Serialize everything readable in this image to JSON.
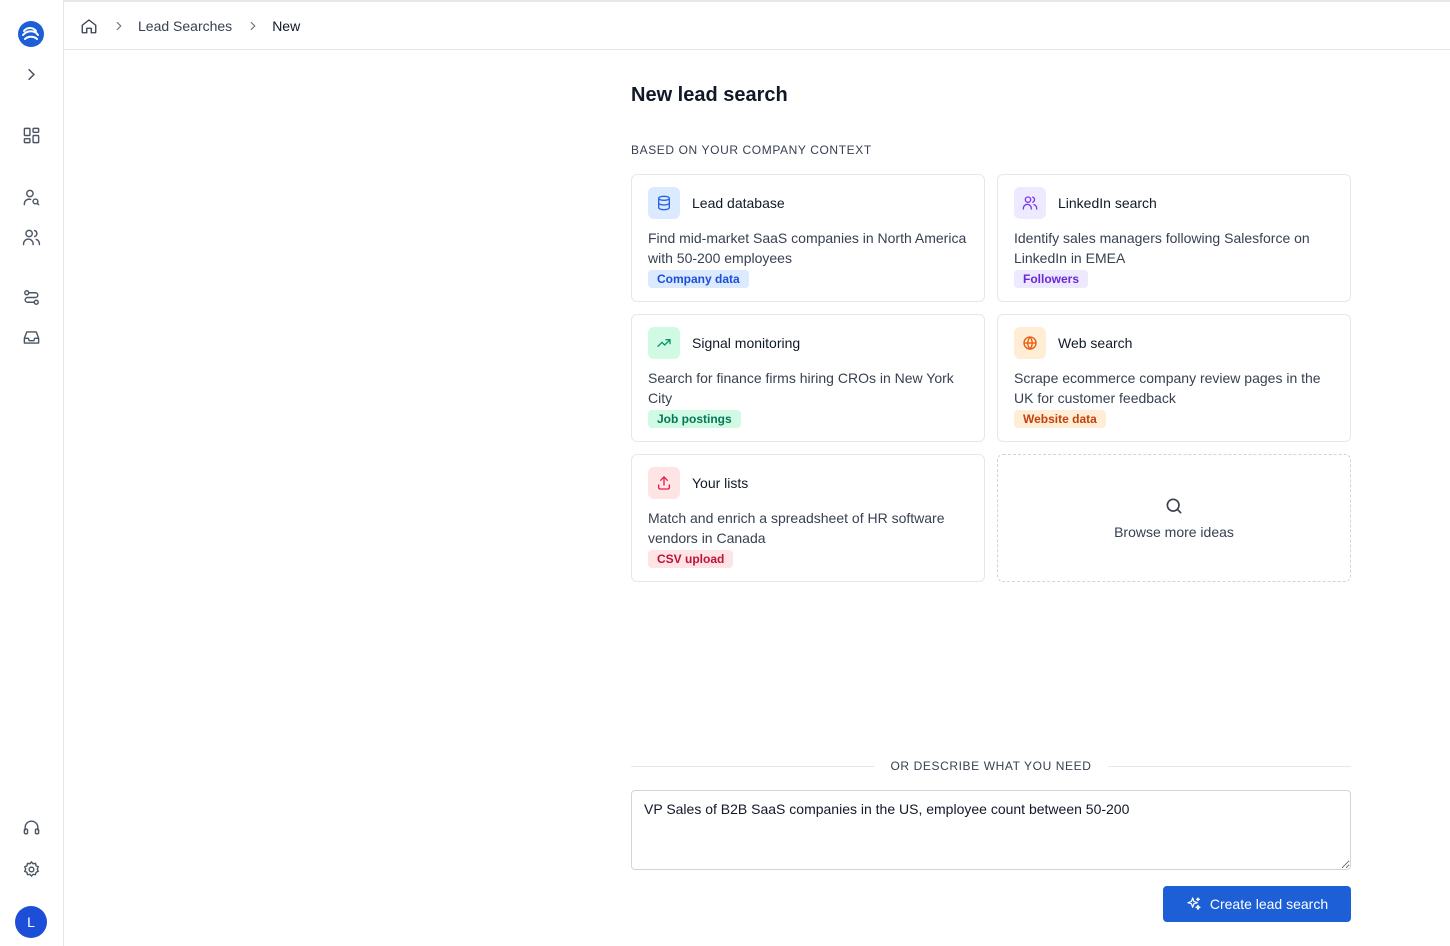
{
  "app": {
    "avatar_initial": "L",
    "accent": "#1d5fd6"
  },
  "sidebar": {
    "icons": [
      "logo-icon",
      "chevron-right-icon",
      "dashboard-icon",
      "user-search-icon",
      "users-icon",
      "workflow-icon",
      "inbox-icon",
      "headphones-icon",
      "gear-icon"
    ]
  },
  "breadcrumb": {
    "items": [
      {
        "label": "Lead Searches"
      },
      {
        "label": "New"
      }
    ]
  },
  "page": {
    "title": "New lead search",
    "section_label": "BASED ON YOUR COMPANY CONTEXT",
    "cards": [
      {
        "title": "Lead database",
        "description": "Find mid-market SaaS companies in North America with 50-200 employees",
        "tag": "Company data",
        "icon": "database-icon",
        "color": "#2563eb"
      },
      {
        "title": "LinkedIn search",
        "description": "Identify sales managers following Salesforce on LinkedIn in EMEA",
        "tag": "Followers",
        "icon": "users-icon",
        "color": "#7c3aed"
      },
      {
        "title": "Signal monitoring",
        "description": "Search for finance firms hiring CROs in New York City",
        "tag": "Job postings",
        "icon": "trending-up-icon",
        "color": "#059669"
      },
      {
        "title": "Web search",
        "description": "Scrape ecommerce company review pages in the UK for customer feedback",
        "tag": "Website data",
        "icon": "globe-icon",
        "color": "#ea580c"
      },
      {
        "title": "Your lists",
        "description": "Match and enrich a spreadsheet of HR software vendors in Canada",
        "tag": "CSV upload",
        "icon": "upload-icon",
        "color": "#e11d48"
      }
    ],
    "browse_label": "Browse more ideas",
    "divider_label": "OR DESCRIBE WHAT YOU NEED",
    "prompt_value": "VP Sales of B2B SaaS companies in the US, employee count between 50-200",
    "create_label": "Create lead search"
  }
}
